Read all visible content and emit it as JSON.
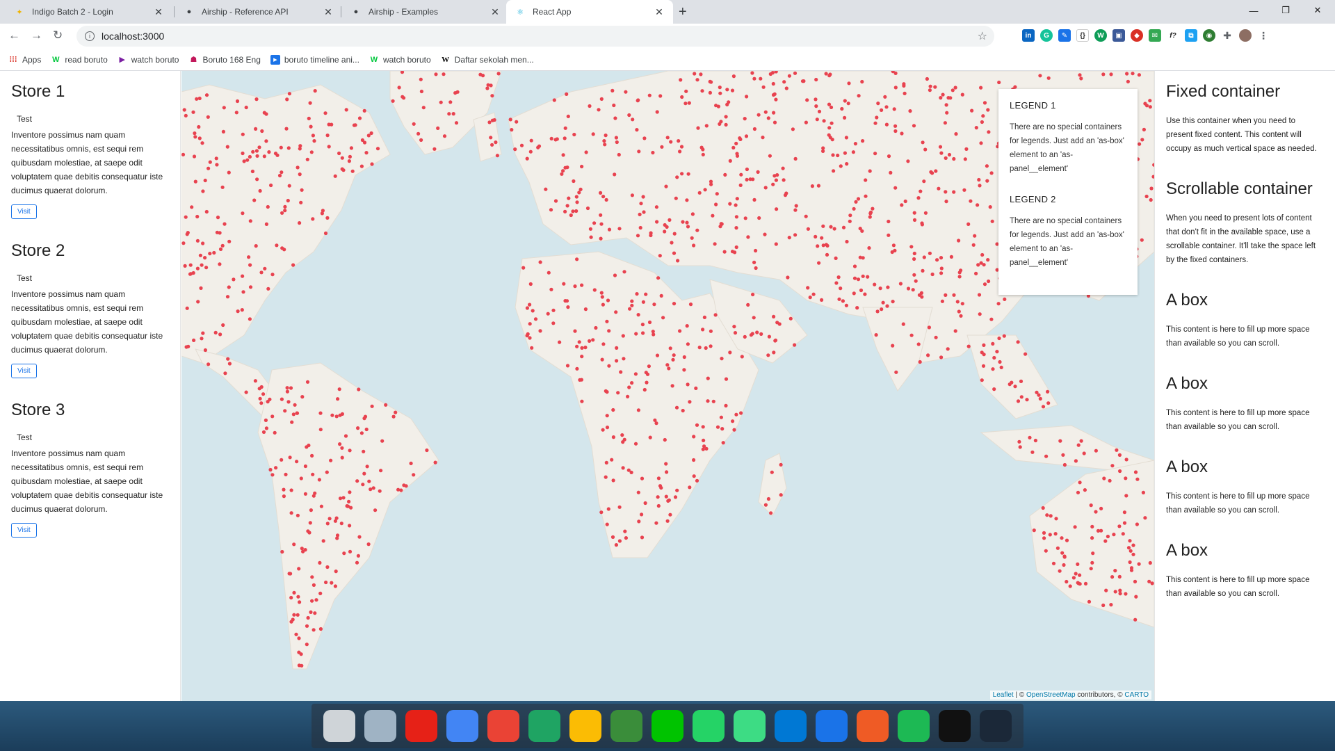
{
  "browser": {
    "tabs": [
      {
        "title": "Indigo Batch 2 - Login",
        "icon": "indigo-logo-icon"
      },
      {
        "title": "Airship - Reference API",
        "icon": "airship-icon"
      },
      {
        "title": "Airship - Examples",
        "icon": "airship-icon"
      },
      {
        "title": "React App",
        "icon": "react-icon",
        "active": true
      }
    ],
    "url": "localhost:3000",
    "bookmarks": [
      {
        "label": "Apps",
        "icon": "apps-grid-icon"
      },
      {
        "label": "read boruto",
        "icon": "webtoon-icon"
      },
      {
        "label": "watch boruto",
        "icon": "play-icon"
      },
      {
        "label": "Boruto 168 Eng",
        "icon": "anime-icon"
      },
      {
        "label": "boruto timeline ani...",
        "icon": "video-icon"
      },
      {
        "label": "watch boruto",
        "icon": "webtoon-icon"
      },
      {
        "label": "Daftar sekolah men...",
        "icon": "wikipedia-icon"
      }
    ]
  },
  "left_panel": {
    "stores": [
      {
        "title": "Store 1",
        "subtitle": "Test",
        "text": "Inventore possimus nam quam necessitatibus omnis, est sequi rem quibusdam molestiae, at saepe odit voluptatem quae debitis consequatur iste ducimus quaerat dolorum.",
        "button": "Visit"
      },
      {
        "title": "Store 2",
        "subtitle": "Test",
        "text": "Inventore possimus nam quam necessitatibus omnis, est sequi rem quibusdam molestiae, at saepe odit voluptatem quae debitis consequatur iste ducimus quaerat dolorum.",
        "button": "Visit"
      },
      {
        "title": "Store 3",
        "subtitle": "Test",
        "text": "Inventore possimus nam quam necessitatibus omnis, est sequi rem quibusdam molestiae, at saepe odit voluptatem quae debitis consequatur iste ducimus quaerat dolorum.",
        "button": "Visit"
      }
    ]
  },
  "map": {
    "marker_color": "#e8424f",
    "water_color": "#d4e6ec",
    "land_color": "#f2efe9",
    "attribution": {
      "leaflet": "Leaflet",
      "sep": " | © ",
      "osm": "OpenStreetMap",
      "contributors": " contributors, © ",
      "carto": "CARTO"
    }
  },
  "legend": [
    {
      "title": "LEGEND 1",
      "text": "There are no special containers for legends. Just add an 'as-box' element to an 'as-panel__element'"
    },
    {
      "title": "LEGEND 2",
      "text": "There are no special containers for legends. Just add an 'as-box' element to an 'as-panel__element'"
    }
  ],
  "right_panel": {
    "fixed": {
      "title": "Fixed container",
      "text": "Use this container when you need to present fixed content. This content will occupy as much vertical space as needed."
    },
    "scrollable": {
      "title": "Scrollable container",
      "text": "When you need to present lots of content that don't fit in the available space, use a scrollable container. It'll take the space left by the fixed containers."
    },
    "boxes": [
      {
        "title": "A box",
        "text": "This content is here to fill up more space than available so you can scroll."
      },
      {
        "title": "A box",
        "text": "This content is here to fill up more space than available so you can scroll."
      },
      {
        "title": "A box",
        "text": "This content is here to fill up more space than available so you can scroll."
      },
      {
        "title": "A box",
        "text": "This content is here to fill up more space than available so you can scroll."
      }
    ]
  },
  "taskbar": {
    "icons": [
      {
        "name": "clock-icon",
        "color": "#cfd4d8"
      },
      {
        "name": "trash-icon",
        "color": "#9fb3c4"
      },
      {
        "name": "youtube-icon",
        "color": "#e62117"
      },
      {
        "name": "chrome-icon",
        "color": "#4285f4"
      },
      {
        "name": "gmail-icon",
        "color": "#ea4335"
      },
      {
        "name": "google-drive-icon",
        "color": "#1fa463"
      },
      {
        "name": "google-keep-icon",
        "color": "#fbbc04"
      },
      {
        "name": "globe-icon",
        "color": "#3a8d3a"
      },
      {
        "name": "line-icon",
        "color": "#00c300"
      },
      {
        "name": "whatsapp-icon",
        "color": "#25d366"
      },
      {
        "name": "android-studio-icon",
        "color": "#3ddc84"
      },
      {
        "name": "vscode-icon",
        "color": "#0078d4"
      },
      {
        "name": "maps-pin-icon",
        "color": "#1a73e8"
      },
      {
        "name": "postman-icon",
        "color": "#ef5b25"
      },
      {
        "name": "spotify-icon",
        "color": "#1db954"
      },
      {
        "name": "epic-games-icon",
        "color": "#111111"
      },
      {
        "name": "steam-icon",
        "color": "#1b2838"
      }
    ]
  }
}
